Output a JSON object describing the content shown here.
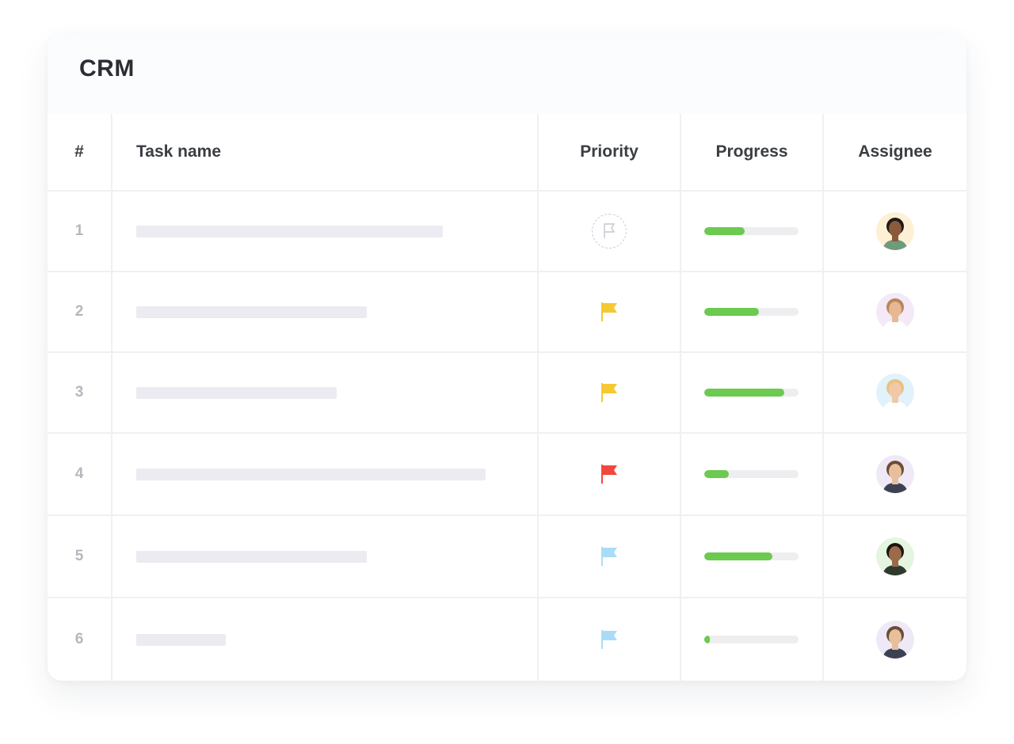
{
  "app": {
    "title": "CRM"
  },
  "table": {
    "headers": {
      "num": "#",
      "task": "Task name",
      "priority": "Priority",
      "progress": "Progress",
      "assignee": "Assignee"
    },
    "rows": [
      {
        "num": "1",
        "task_fill": 0.72,
        "priority": "none",
        "progress": 0.43,
        "avatar_bg": "#fdf0d5",
        "skin": "#8a5a3b",
        "hair": "#1f1a17",
        "shirt": "#6d9b7c"
      },
      {
        "num": "2",
        "task_fill": 0.54,
        "priority": "yellow",
        "progress": 0.58,
        "avatar_bg": "#f3e9f7",
        "skin": "#e7b894",
        "hair": "#b9865a",
        "shirt": "#ffffff"
      },
      {
        "num": "3",
        "task_fill": 0.47,
        "priority": "yellow",
        "progress": 0.85,
        "avatar_bg": "#e2f2fb",
        "skin": "#f1c9a8",
        "hair": "#e6c27d",
        "shirt": "#ffffff"
      },
      {
        "num": "4",
        "task_fill": 0.82,
        "priority": "red",
        "progress": 0.26,
        "avatar_bg": "#efe9f7",
        "skin": "#e8bf9c",
        "hair": "#6b4c36",
        "shirt": "#3c4251"
      },
      {
        "num": "5",
        "task_fill": 0.54,
        "priority": "blue",
        "progress": 0.72,
        "avatar_bg": "#e4f5e0",
        "skin": "#9a6a49",
        "hair": "#1a1411",
        "shirt": "#2f3a2f"
      },
      {
        "num": "6",
        "task_fill": 0.21,
        "priority": "blue",
        "progress": 0.06,
        "avatar_bg": "#efe9f7",
        "skin": "#e8bf9c",
        "hair": "#6b4c36",
        "shirt": "#3c4251"
      }
    ]
  },
  "colors": {
    "flag_yellow": "#f6c832",
    "flag_red": "#f2473e",
    "flag_blue": "#a9dcf6",
    "progress_green": "#6bca4f",
    "progress_track": "#eeedf0",
    "task_placeholder": "#ebebf1"
  },
  "icons": {
    "priority_none": "flag-outline-icon",
    "priority_flag": "flag-icon"
  }
}
